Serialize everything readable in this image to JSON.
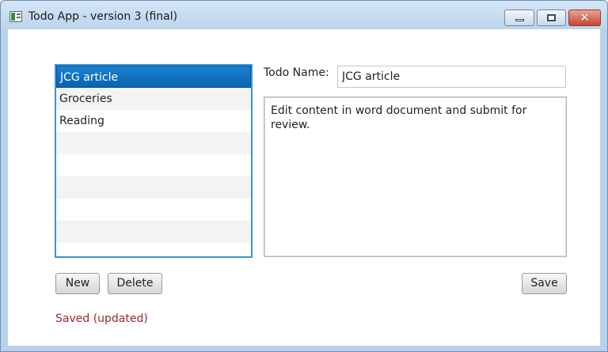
{
  "window": {
    "title": "Todo App - version 3 (final)",
    "controls": {
      "minimize": "minimize-icon",
      "maximize": "maximize-icon",
      "close": "close-icon"
    }
  },
  "todo_list": {
    "items": [
      "JCG article",
      "Groceries",
      "Reading"
    ],
    "selected_index": 0,
    "empty_rows": 6
  },
  "editor": {
    "name_label": "Todo Name:",
    "name_value": "JCG article",
    "description": "Edit content in word document and submit for review."
  },
  "buttons": {
    "new_label": "New",
    "delete_label": "Delete",
    "save_label": "Save"
  },
  "status": {
    "text": "Saved (updated)",
    "color": "#a0282d"
  },
  "colors": {
    "selection": "#0a6bbf",
    "list_border": "#3d93d4"
  }
}
